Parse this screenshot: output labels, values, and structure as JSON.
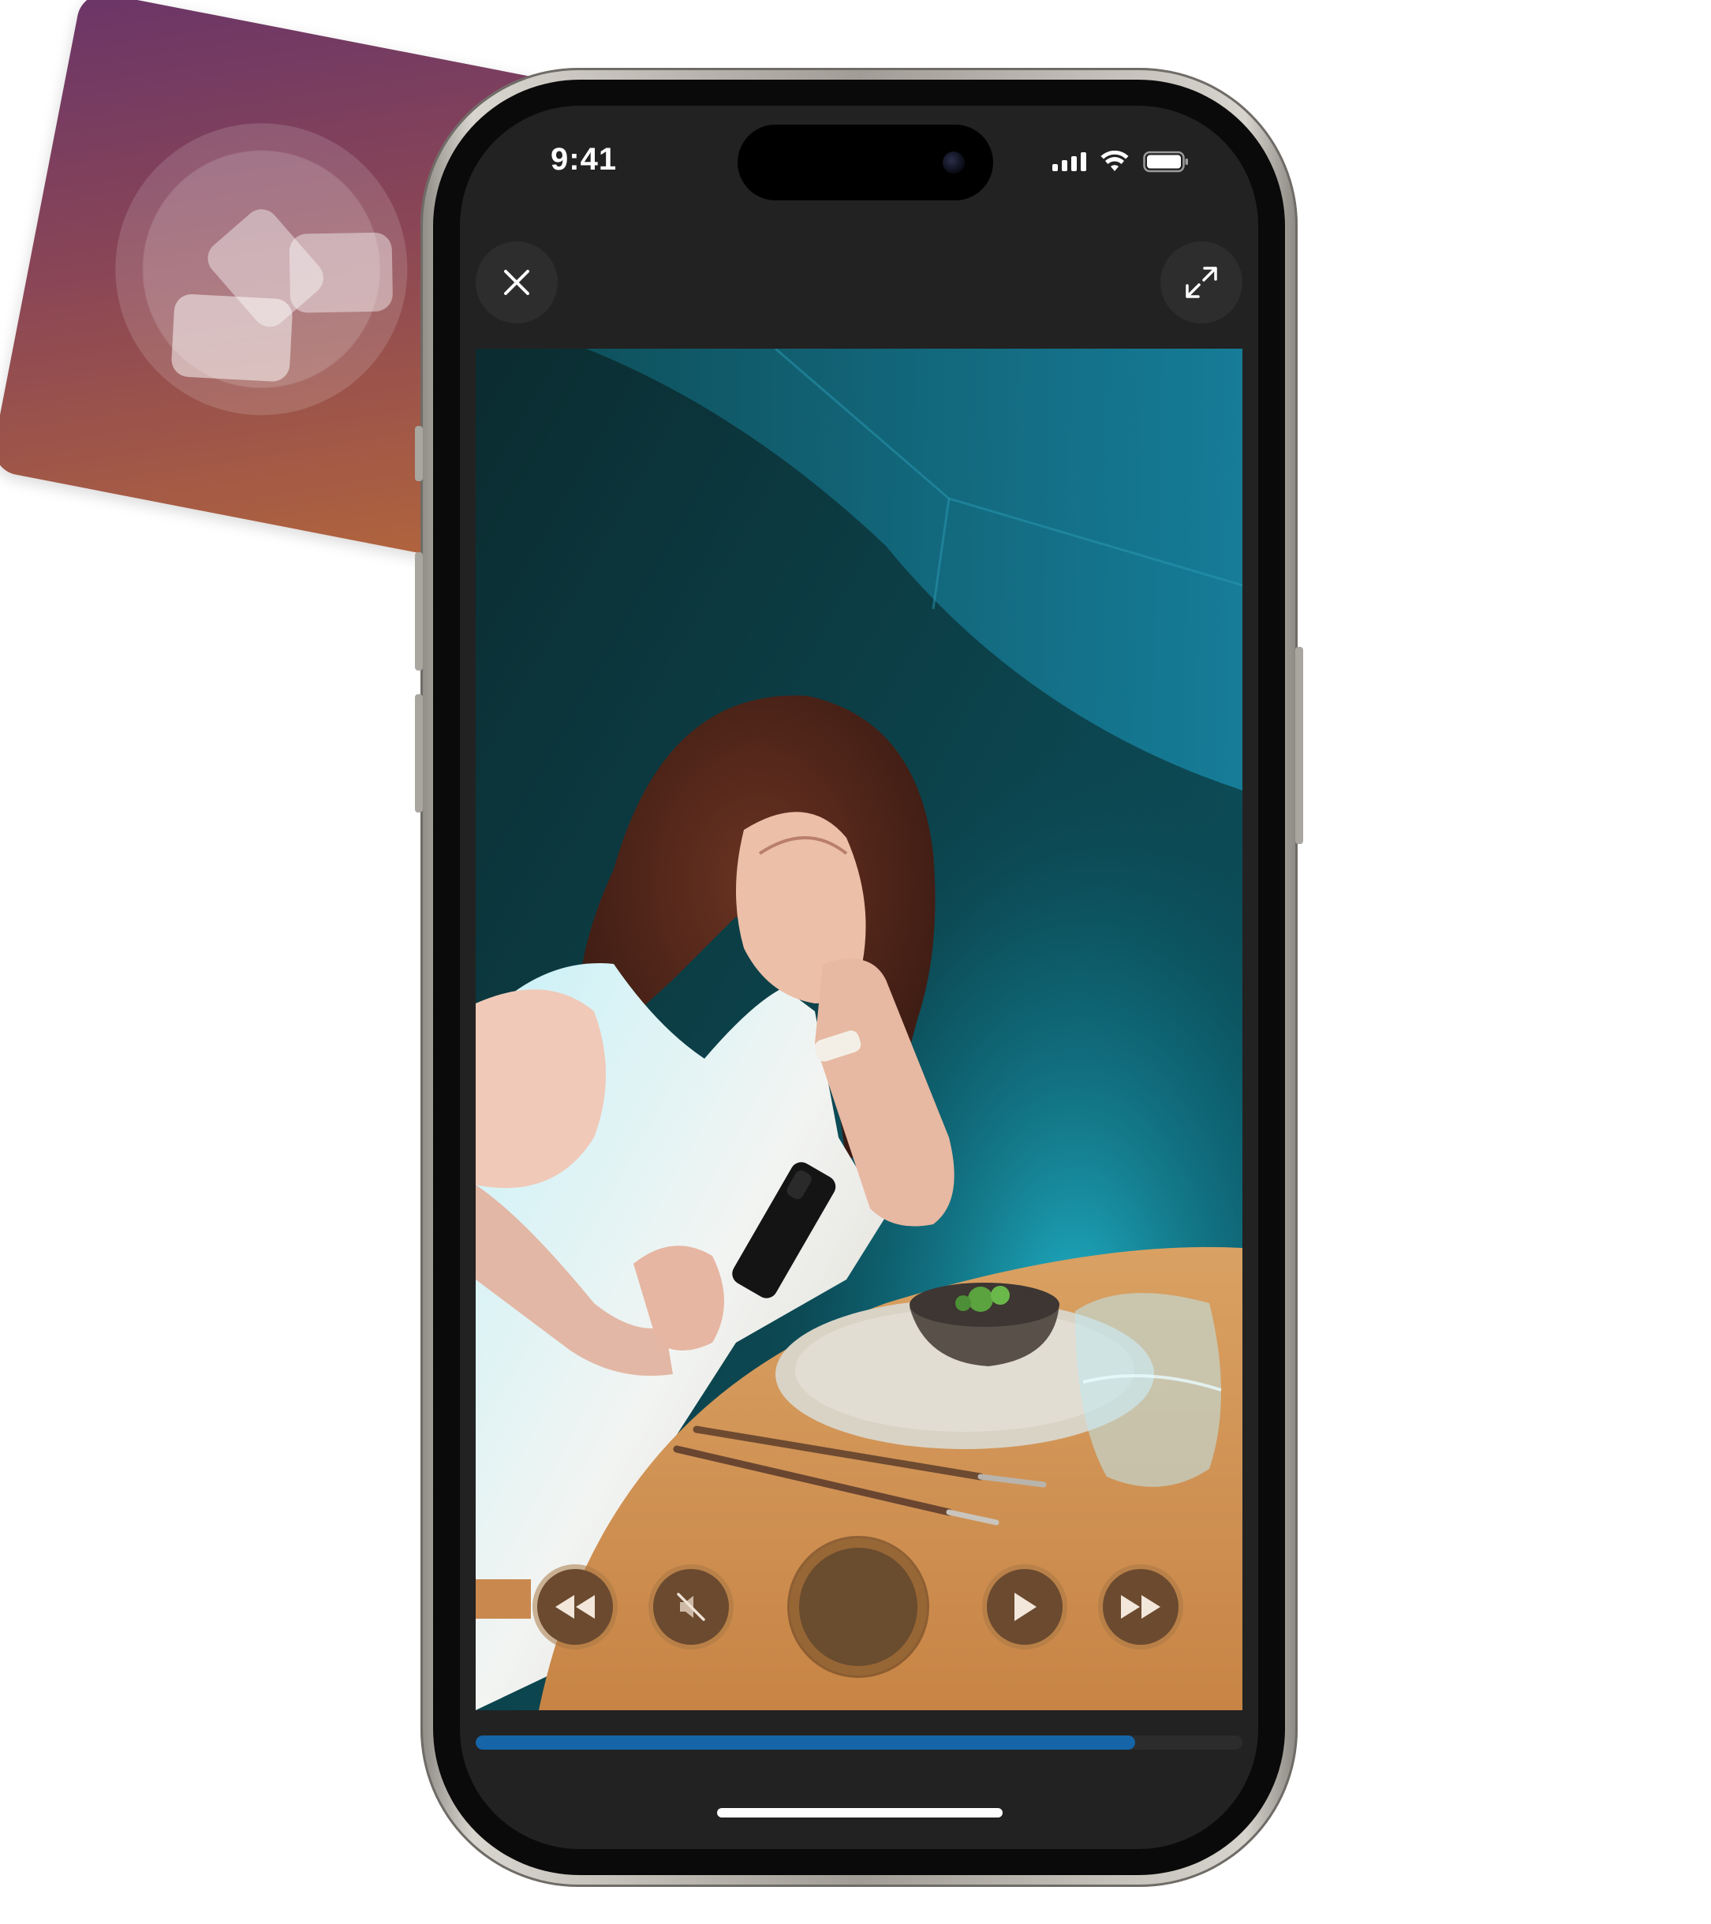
{
  "status_bar": {
    "time": "9:41",
    "icons": [
      "cellular-signal-icon",
      "wifi-icon",
      "battery-icon"
    ]
  },
  "app_icon": {
    "icon": "stacked-cards-icon"
  },
  "toolbar": {
    "close_icon": "close-icon",
    "expand_icon": "expand-icon"
  },
  "video": {
    "scene": "photo"
  },
  "controls": {
    "rewind_icon": "rewind-icon",
    "mute_icon": "muted-speaker-icon",
    "record_icon": "record-icon",
    "play_icon": "play-icon",
    "forward_icon": "fast-forward-icon"
  },
  "playback": {
    "progress_fraction": 0.86
  },
  "colors": {
    "screen_bg": "#222222",
    "progress": "#1565a8",
    "control_fill": "#6b4a2f"
  }
}
